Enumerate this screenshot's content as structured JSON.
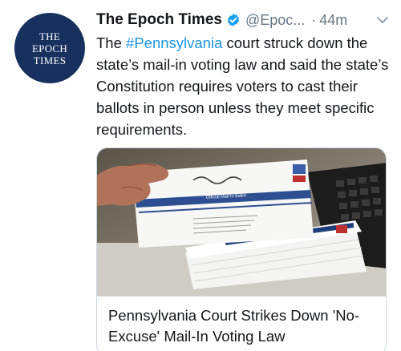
{
  "account": {
    "display_name": "The Epoch Times",
    "handle": "@Epoc...",
    "separator": "·",
    "time": "44m",
    "avatar_lines": [
      "THE",
      "EPOCH",
      "TIMES"
    ]
  },
  "tweet": {
    "text_before": "The ",
    "hashtag": "#Pennsylvania",
    "text_after": " court struck down the state’s mail-in voting law and said the state’s Constitution requires voters to cast their ballots in person unless they meet specific requirements."
  },
  "card": {
    "title": "Pennsylvania Court Strikes Down 'No-Excuse' Mail-In Voting Law",
    "image": {
      "envelope_label": "Official Mail-In Ballot"
    }
  },
  "icons": {
    "verified": "verified-badge-icon",
    "menu": "chevron-down-icon"
  },
  "colors": {
    "brand_navy": "#18305e",
    "link_blue": "#1b95e0",
    "verified_blue": "#1da1f2",
    "secondary_text": "#657786"
  }
}
